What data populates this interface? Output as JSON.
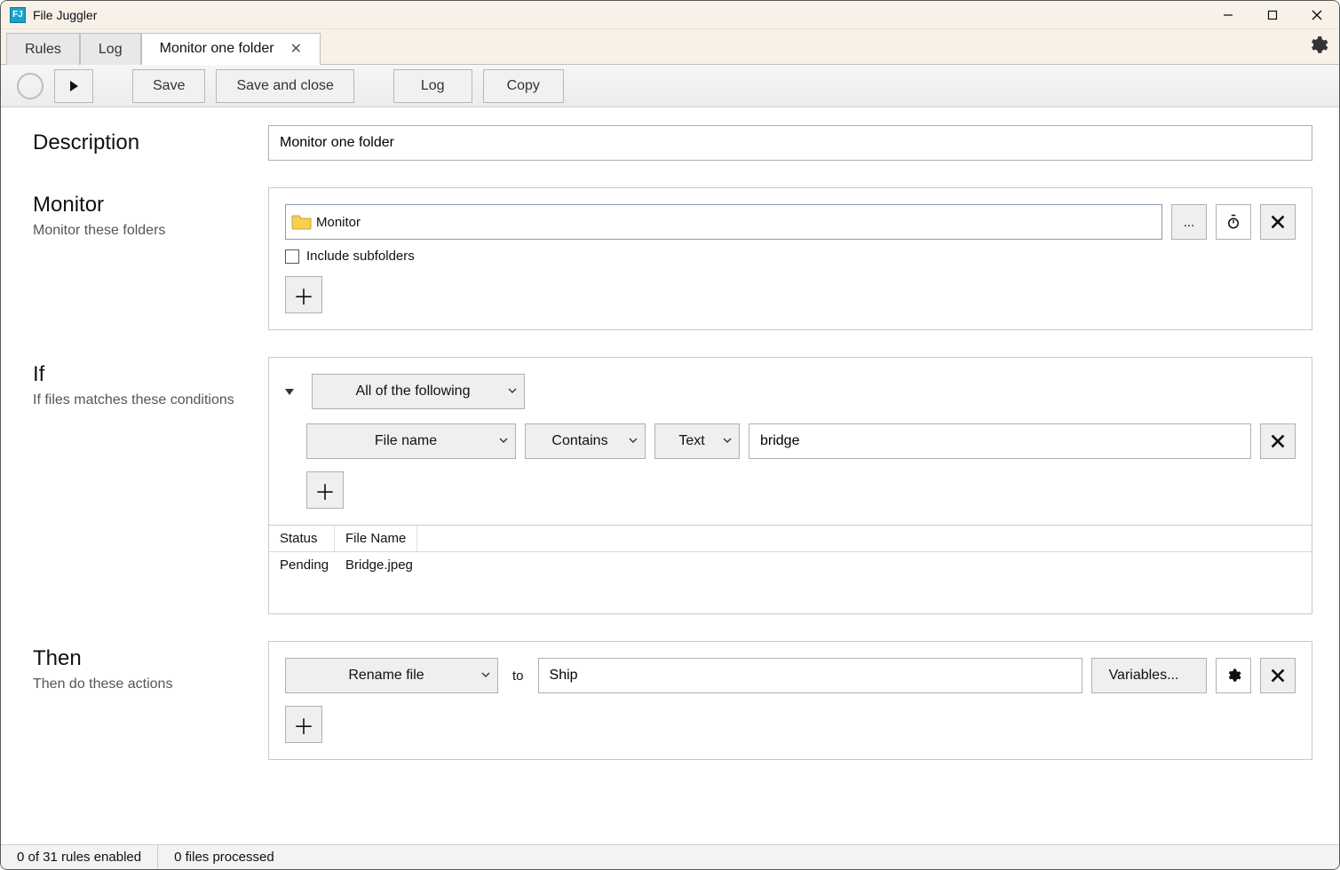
{
  "app": {
    "title": "File Juggler",
    "icon_text": "FJ"
  },
  "window_controls": {
    "minimize": "minimize",
    "maximize": "maximize",
    "close": "close"
  },
  "tabs": {
    "items": [
      {
        "label": "Rules",
        "active": false
      },
      {
        "label": "Log",
        "active": false
      },
      {
        "label": "Monitor one folder",
        "active": true,
        "closable": true
      }
    ]
  },
  "toolbar": {
    "run_state": "stopped",
    "play": "▶",
    "save": "Save",
    "save_close": "Save and close",
    "log": "Log",
    "copy": "Copy"
  },
  "sections": {
    "description": {
      "title": "Description",
      "value": "Monitor one folder"
    },
    "monitor": {
      "title": "Monitor",
      "subtitle": "Monitor these folders",
      "folder": "Monitor",
      "browse": "...",
      "include_subfolders_label": "Include subfolders",
      "include_subfolders_checked": false
    },
    "if": {
      "title": "If",
      "subtitle": "If files matches these conditions",
      "group_mode": "All of the following",
      "condition": {
        "field": "File name",
        "operator": "Contains",
        "type": "Text",
        "value": "bridge"
      },
      "results": {
        "columns": [
          "Status",
          "File Name"
        ],
        "rows": [
          {
            "status": "Pending",
            "filename": "Bridge.jpeg"
          }
        ]
      }
    },
    "then": {
      "title": "Then",
      "subtitle": "Then do these actions",
      "action": "Rename file",
      "to_label": "to",
      "to_value": "Ship",
      "variables_label": "Variables..."
    }
  },
  "statusbar": {
    "rules": "0 of 31 rules enabled",
    "processed": "0 files processed"
  }
}
